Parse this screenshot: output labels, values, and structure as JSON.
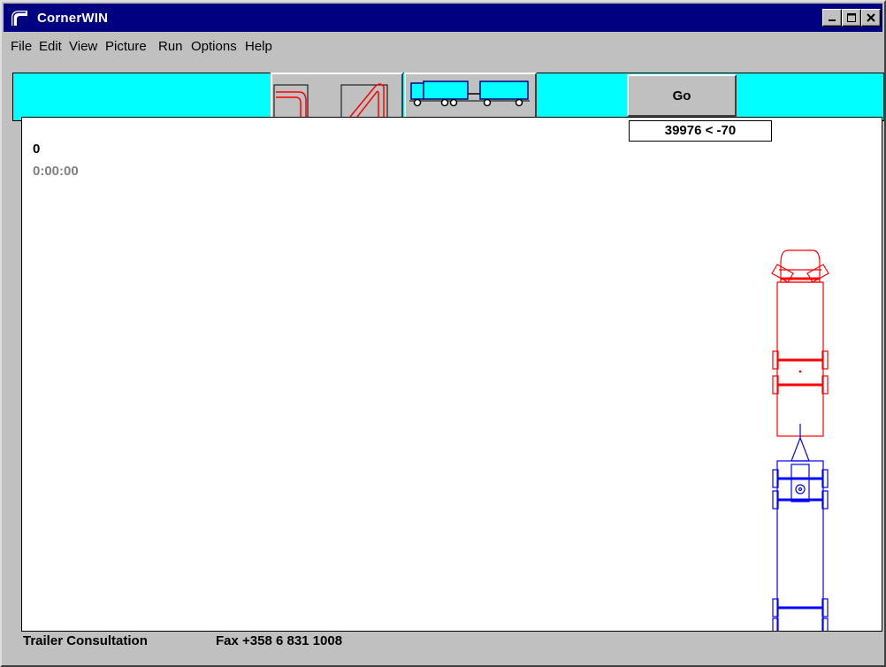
{
  "window": {
    "title": "CornerWIN",
    "icon": "cornerwin-app-icon",
    "controls": [
      "minimize-icon",
      "maximize-icon",
      "close-icon"
    ]
  },
  "menu": [
    {
      "label": "File"
    },
    {
      "label": "Edit"
    },
    {
      "label": "View"
    },
    {
      "label": "Picture"
    },
    {
      "label": "Run"
    },
    {
      "label": "Options"
    },
    {
      "label": "Help"
    }
  ],
  "toolbar": {
    "background_color": "#00ffff",
    "road_button_icon": "road-curves-icon",
    "vehicle_button_icon": "truck-trailer-icon",
    "go_label": "Go",
    "coordinate_readout": "39976 < -70"
  },
  "canvas": {
    "counter": "0",
    "timer": "0:00:00",
    "truck_color": "#ff0000",
    "trailer_color": "#0000ff"
  },
  "status": {
    "company": "Trailer Consultation",
    "fax": "Fax +358 6 831 1008"
  }
}
